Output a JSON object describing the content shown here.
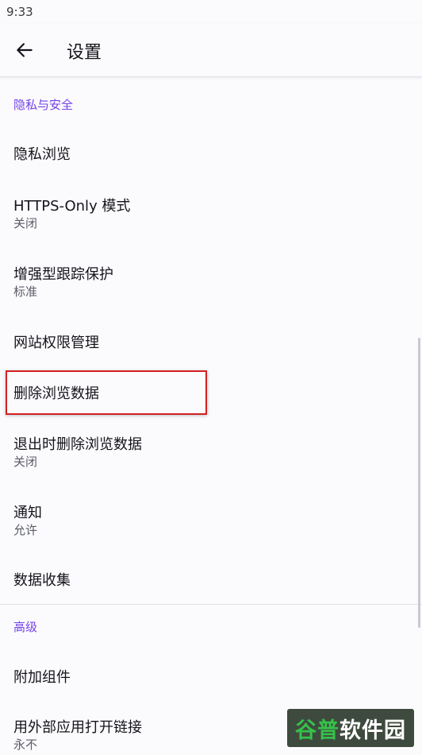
{
  "status_bar": {
    "time": "9:33"
  },
  "app_bar": {
    "title": "设置",
    "back_icon": "arrow-left-icon"
  },
  "sections": {
    "privacy": {
      "header": "隐私与安全",
      "items": [
        {
          "label": "隐私浏览"
        },
        {
          "label": "HTTPS-Only 模式",
          "summary": "关闭"
        },
        {
          "label": "增强型跟踪保护",
          "summary": "标准"
        },
        {
          "label": "网站权限管理"
        },
        {
          "label": "删除浏览数据"
        },
        {
          "label": "退出时删除浏览数据",
          "summary": "关闭"
        },
        {
          "label": "通知",
          "summary": "允许"
        },
        {
          "label": "数据收集"
        }
      ]
    },
    "advanced": {
      "header": "高级",
      "items": [
        {
          "label": "附加组件"
        },
        {
          "label": "用外部应用打开链接",
          "summary": "永不"
        }
      ]
    }
  },
  "watermark": {
    "part1": "谷普",
    "part2": "软件园"
  },
  "colors": {
    "accent": "#7542e5",
    "highlight_border": "#d42020",
    "background": "#fbfbfe"
  }
}
